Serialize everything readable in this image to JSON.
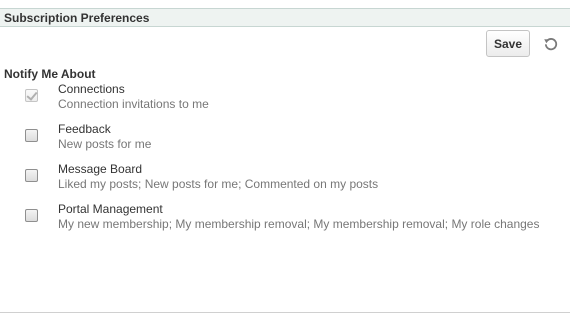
{
  "panel": {
    "title": "Subscription Preferences"
  },
  "toolbar": {
    "save_label": "Save",
    "revert_icon": "revert-icon"
  },
  "notify": {
    "heading": "Notify Me About",
    "items": [
      {
        "title": "Connections",
        "description": "Connection invitations to me",
        "checked": true,
        "disabled": true
      },
      {
        "title": "Feedback",
        "description": "New posts for me",
        "checked": false,
        "disabled": false
      },
      {
        "title": "Message Board",
        "description": "Liked my posts; New posts for me; Commented on my posts",
        "checked": false,
        "disabled": false
      },
      {
        "title": "Portal Management",
        "description": "My new membership; My membership removal; My membership removal; My role changes",
        "checked": false,
        "disabled": false
      }
    ]
  },
  "colors": {
    "header_background": "#eef3f1",
    "header_border": "#c7d6d2",
    "primary_text": "#333333",
    "secondary_text": "#777777"
  }
}
